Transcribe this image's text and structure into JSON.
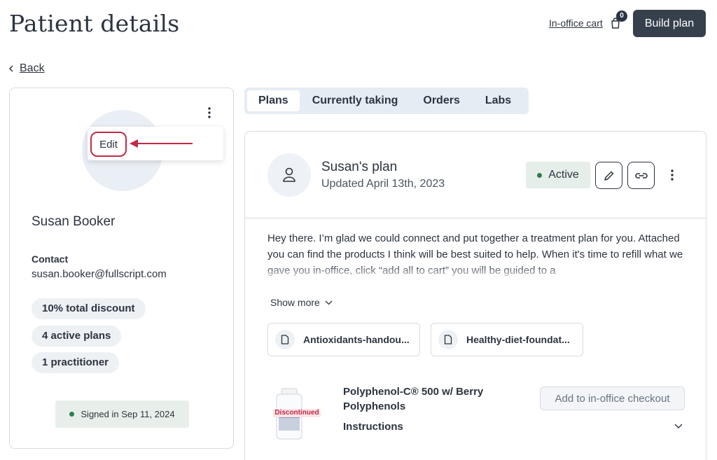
{
  "header": {
    "title": "Patient details",
    "cart_label": "In-office cart",
    "cart_count": "0",
    "build_plan_label": "Build plan"
  },
  "nav": {
    "back_label": "Back"
  },
  "patient": {
    "menu_edit_label": "Edit",
    "name": "Susan Booker",
    "contact_label": "Contact",
    "email": "susan.booker@fullscript.com",
    "pills": [
      "10% total discount",
      "4 active plans",
      "1 practitioner"
    ],
    "signed_in": "Signed in Sep 11, 2024"
  },
  "tabs": [
    {
      "label": "Plans",
      "active": true
    },
    {
      "label": "Currently taking",
      "active": false
    },
    {
      "label": "Orders",
      "active": false
    },
    {
      "label": "Labs",
      "active": false
    }
  ],
  "plan": {
    "title": "Susan's plan",
    "updated": "Updated April 13th, 2023",
    "status": "Active",
    "message": "Hey there. I’m glad we could connect and put together a treatment plan for you. Attached you can find the products I think will be best suited to help. When it's time to refill what we gave you in-office, click “add all to cart” you will be guided to a",
    "show_more_label": "Show more",
    "files": [
      "Antioxidants-handou...",
      "Healthy-diet-foundat..."
    ],
    "product": {
      "name": "Polyphenol-C® 500 w/ Berry Polyphenols",
      "badge": "Discontinued",
      "instructions_label": "Instructions",
      "add_label": "Add to in-office checkout"
    }
  },
  "colors": {
    "primary_button": "#36404d",
    "accent_red": "#c22a47",
    "status_green": "#2f7d4f",
    "tab_bg": "#e6ecf3"
  }
}
